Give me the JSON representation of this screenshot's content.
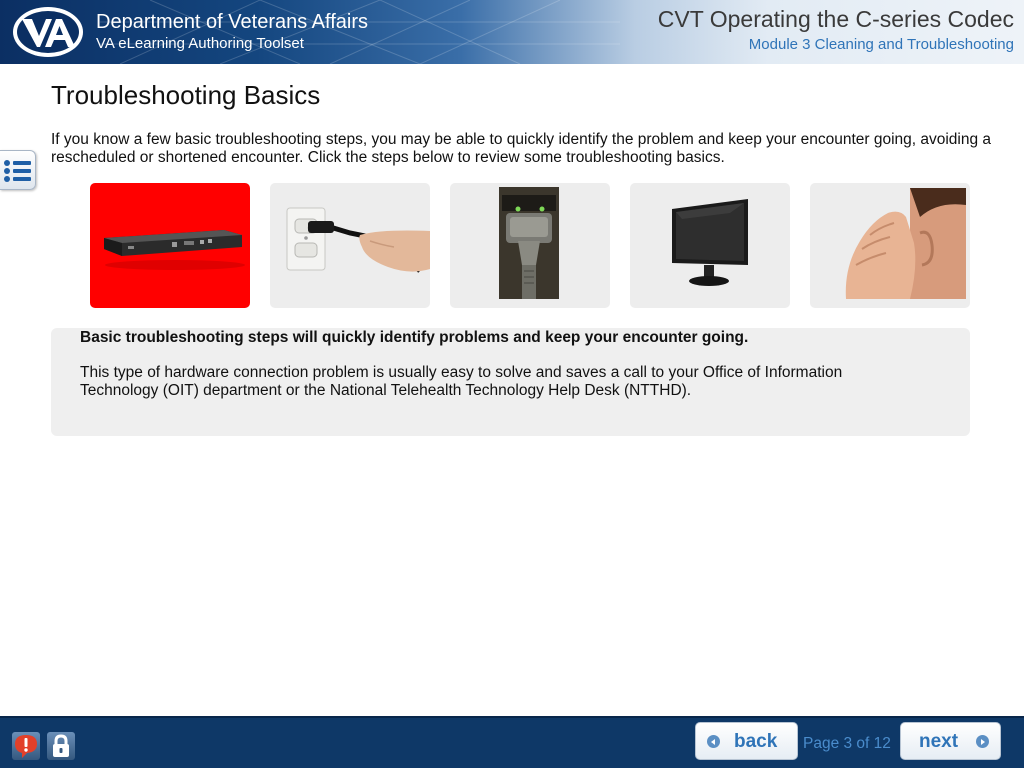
{
  "header": {
    "org_title": "Department of Veterans Affairs",
    "org_subtitle": "VA eLearning Authoring Toolset",
    "course_title": "CVT Operating the C-series Codec",
    "module_title": "Module 3 Cleaning and Troubleshooting",
    "logo_text": "VA"
  },
  "menu": {
    "icon": "list-icon"
  },
  "page": {
    "title": "Troubleshooting Basics",
    "intro": "If you know a few basic troubleshooting steps, you may be able to quickly identify the problem and keep your encounter going, avoiding a rescheduled or shortened encounter. Click the steps below to review some troubleshooting basics."
  },
  "tiles": [
    {
      "name": "codec-unit",
      "selected": true
    },
    {
      "name": "power-plug",
      "selected": false
    },
    {
      "name": "network-cable",
      "selected": false
    },
    {
      "name": "monitor",
      "selected": false
    },
    {
      "name": "listen",
      "selected": false
    }
  ],
  "info": {
    "heading": "Basic troubleshooting steps will quickly identify problems and keep your encounter going.",
    "body": "This type of hardware connection problem is usually easy to solve and saves a call to your Office of Information Technology (OIT) department or the National Telehealth Technology Help Desk (NTTHD)."
  },
  "footer": {
    "alert_icon": "alert-icon",
    "lock_icon": "lock-icon",
    "back_label": "back",
    "next_label": "next",
    "page_counter": "Page 3 of 12"
  },
  "colors": {
    "header_dark": "#0b2f63",
    "footer": "#0e3867",
    "accent_blue": "#2f74b8",
    "selected_tile": "#ff0000"
  }
}
